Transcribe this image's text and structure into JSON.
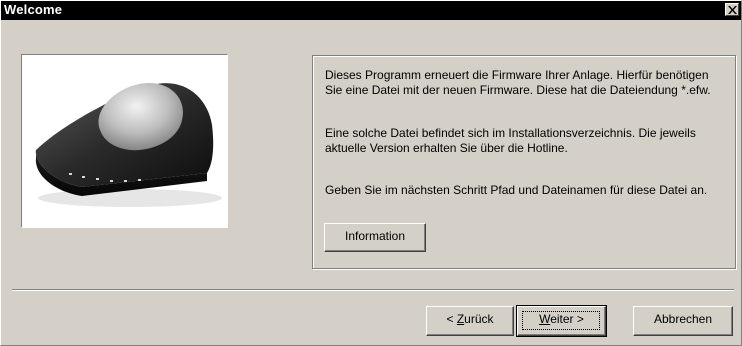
{
  "window": {
    "title": "Welcome",
    "close_glyph": "×",
    "close_icon": "close-icon"
  },
  "image": {
    "icon": "router-device-image"
  },
  "description": {
    "paragraph1": "Dieses Programm erneuert die Firmware Ihrer Anlage. Hierfür benötigen Sie eine Datei mit der neuen Firmware. Diese hat die Dateiendung *.efw.",
    "paragraph2": "Eine solche Datei befindet sich im Installationsverzeichnis. Die jeweils aktuelle Version erhalten Sie über die Hotline.",
    "paragraph3": "Geben Sie im nächsten Schritt Pfad und Dateinamen für diese Datei an."
  },
  "buttons": {
    "information": "Information",
    "back_prefix": "< ",
    "back_mnemonic": "Z",
    "back_rest": "urück",
    "next_mnemonic": "W",
    "next_rest": "eiter >",
    "cancel": "Abbrechen"
  },
  "colors": {
    "titlebar": "#000000",
    "dialog_bg": "#d4d0c8",
    "image_bg": "#ffffff"
  }
}
